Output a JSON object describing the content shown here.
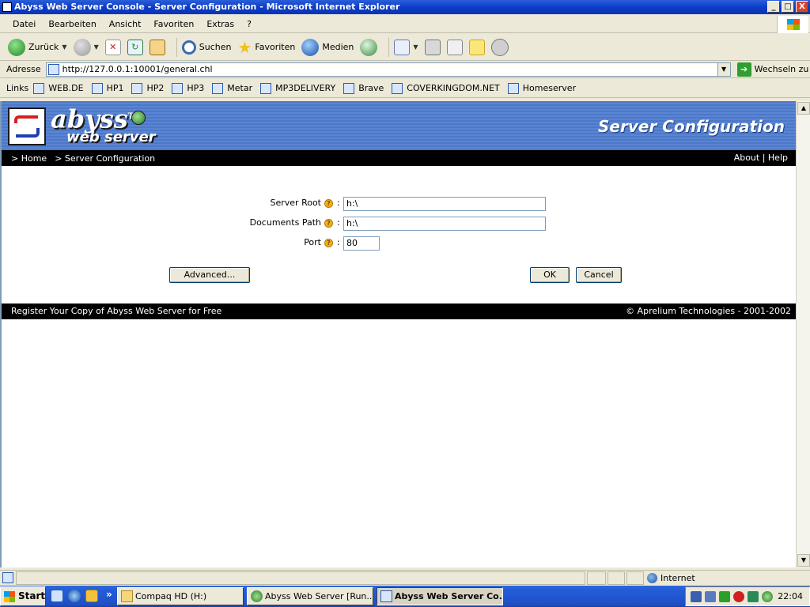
{
  "window": {
    "title": "Abyss Web Server Console - Server Configuration - Microsoft Internet Explorer",
    "controls": [
      "_",
      "□",
      "X"
    ]
  },
  "menu": [
    "Datei",
    "Bearbeiten",
    "Ansicht",
    "Favoriten",
    "Extras",
    "?"
  ],
  "toolbar": {
    "back": "Zurück",
    "search": "Suchen",
    "favorites": "Favoriten",
    "media": "Medien"
  },
  "address": {
    "label": "Adresse",
    "url": "http://127.0.0.1:10001/general.chl",
    "go": "Wechseln zu"
  },
  "links": {
    "label": "Links",
    "items": [
      "WEB.DE",
      "HP1",
      "HP2",
      "HP3",
      "Metar",
      "MP3DELIVERY",
      "Brave",
      "COVERKINGDOM.NET",
      "Homeserver"
    ]
  },
  "page": {
    "logo_text": "abyss",
    "logo_tm": "TM",
    "logo_sub": "web server",
    "header_title": "Server Configuration",
    "breadcrumb": [
      "> Home",
      "> Server Configuration"
    ],
    "top_links": "About | Help",
    "form": {
      "server_root_label": "Server Root",
      "server_root_value": "h:\\",
      "documents_path_label": "Documents Path",
      "documents_path_value": "h:\\",
      "port_label": "Port",
      "port_value": "80",
      "help_glyph": "?",
      "colon": ":"
    },
    "buttons": {
      "advanced": "Advanced...",
      "ok": "OK",
      "cancel": "Cancel"
    },
    "footer_left": "Register Your Copy of Abyss Web Server for Free",
    "footer_right": "© Aprelium Technologies - 2001-2002"
  },
  "status": {
    "zone": "Internet"
  },
  "taskbar": {
    "start": "Start",
    "tasks": [
      {
        "label": "Compaq HD (H:)",
        "active": false
      },
      {
        "label": "Abyss Web Server [Run...",
        "active": false
      },
      {
        "label": "Abyss Web Server Co...",
        "active": true
      }
    ],
    "clock": "22:04",
    "more": "»"
  },
  "colors": {
    "title_bar": "#0c3cc8",
    "header_blue": "#5a85d3",
    "black_bar": "#000000",
    "help_icon": "#f2b01e"
  }
}
